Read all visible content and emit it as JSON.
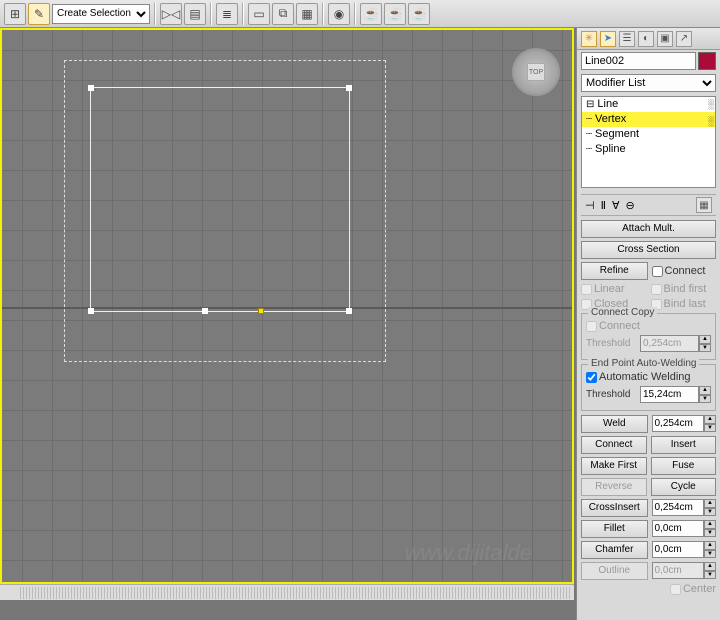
{
  "toolbar": {
    "select_label": "Create Selection Se"
  },
  "compass": {
    "face": "TOP"
  },
  "watermark": "www.dijitalde",
  "panel": {
    "object_name": "Line002",
    "modlist_label": "Modifier List",
    "stack": {
      "line": "Line",
      "vertex": "Vertex",
      "segment": "Segment",
      "spline": "Spline"
    },
    "geom": {
      "attach_mult": "Attach Mult.",
      "cross_section": "Cross Section",
      "refine": "Refine",
      "connect": "Connect",
      "linear": "Linear",
      "bind_first": "Bind first",
      "closed": "Closed",
      "bind_last": "Bind last",
      "connect_copy_title": "Connect Copy",
      "threshold": "Threshold",
      "cc_threshold_val": "0,254cm",
      "auto_weld_title": "End Point Auto-Welding",
      "auto_welding": "Automatic Welding",
      "aw_threshold_val": "15,24cm",
      "weld": "Weld",
      "weld_val": "0,254cm",
      "connect2": "Connect",
      "insert": "Insert",
      "make_first": "Make First",
      "fuse": "Fuse",
      "reverse": "Reverse",
      "cycle": "Cycle",
      "crossinsert": "CrossInsert",
      "ci_val": "0,254cm",
      "fillet": "Fillet",
      "fillet_val": "0,0cm",
      "chamfer": "Chamfer",
      "chamfer_val": "0,0cm",
      "outline": "Outline",
      "outline_val": "0,0cm",
      "center": "Center"
    }
  }
}
